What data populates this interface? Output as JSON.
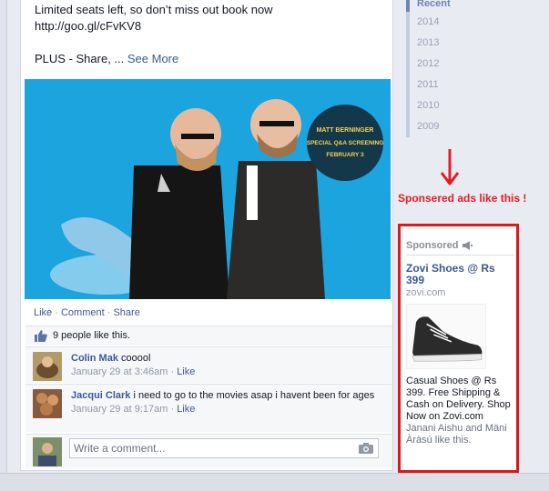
{
  "post": {
    "text_line1": "Limited seats left, so don’t miss out book now",
    "link": "http://goo.gl/cFvKV8",
    "plus_text": "PLUS - Share, ... ",
    "see_more": "See More",
    "photo_badge": [
      "MATT BERNINGER",
      "SPECIAL Q&A SCREENING",
      "FEBRUARY 3"
    ],
    "actions": {
      "like": "Like",
      "comment": "Comment",
      "share": "Share",
      "sep": "·"
    },
    "likes": "9 people like this."
  },
  "comments": [
    {
      "author": "Colin Mak",
      "text": "cooool",
      "time": "January 29 at 3:46am",
      "like": "Like"
    },
    {
      "author": "Jacqui Clark",
      "text": "i need to go to the movies asap i havent been for ages",
      "time": "January 29 at 9:17am",
      "like": "Like"
    }
  ],
  "comment_box": {
    "placeholder": "Write a comment..."
  },
  "timeline": {
    "recent": "Recent",
    "years": [
      "2014",
      "2013",
      "2012",
      "2011",
      "2010",
      "2009"
    ]
  },
  "annotation": "Sponsered ads like this !",
  "sponsored": {
    "header": "Sponsored",
    "ad_title": "Zovi Shoes @ Rs 399",
    "domain": "zovi.com",
    "body": "Casual Shoes @ Rs 399. Free Shipping & Cash on Delivery. Shop Now on Zovi.com",
    "social": "Janani Aishu and Mäni Àràsú like this."
  },
  "colors": {
    "link": "#3b5998",
    "photo_bg": "#1ca4de",
    "highlight": "#d81a1a",
    "badge": "#12384a"
  }
}
